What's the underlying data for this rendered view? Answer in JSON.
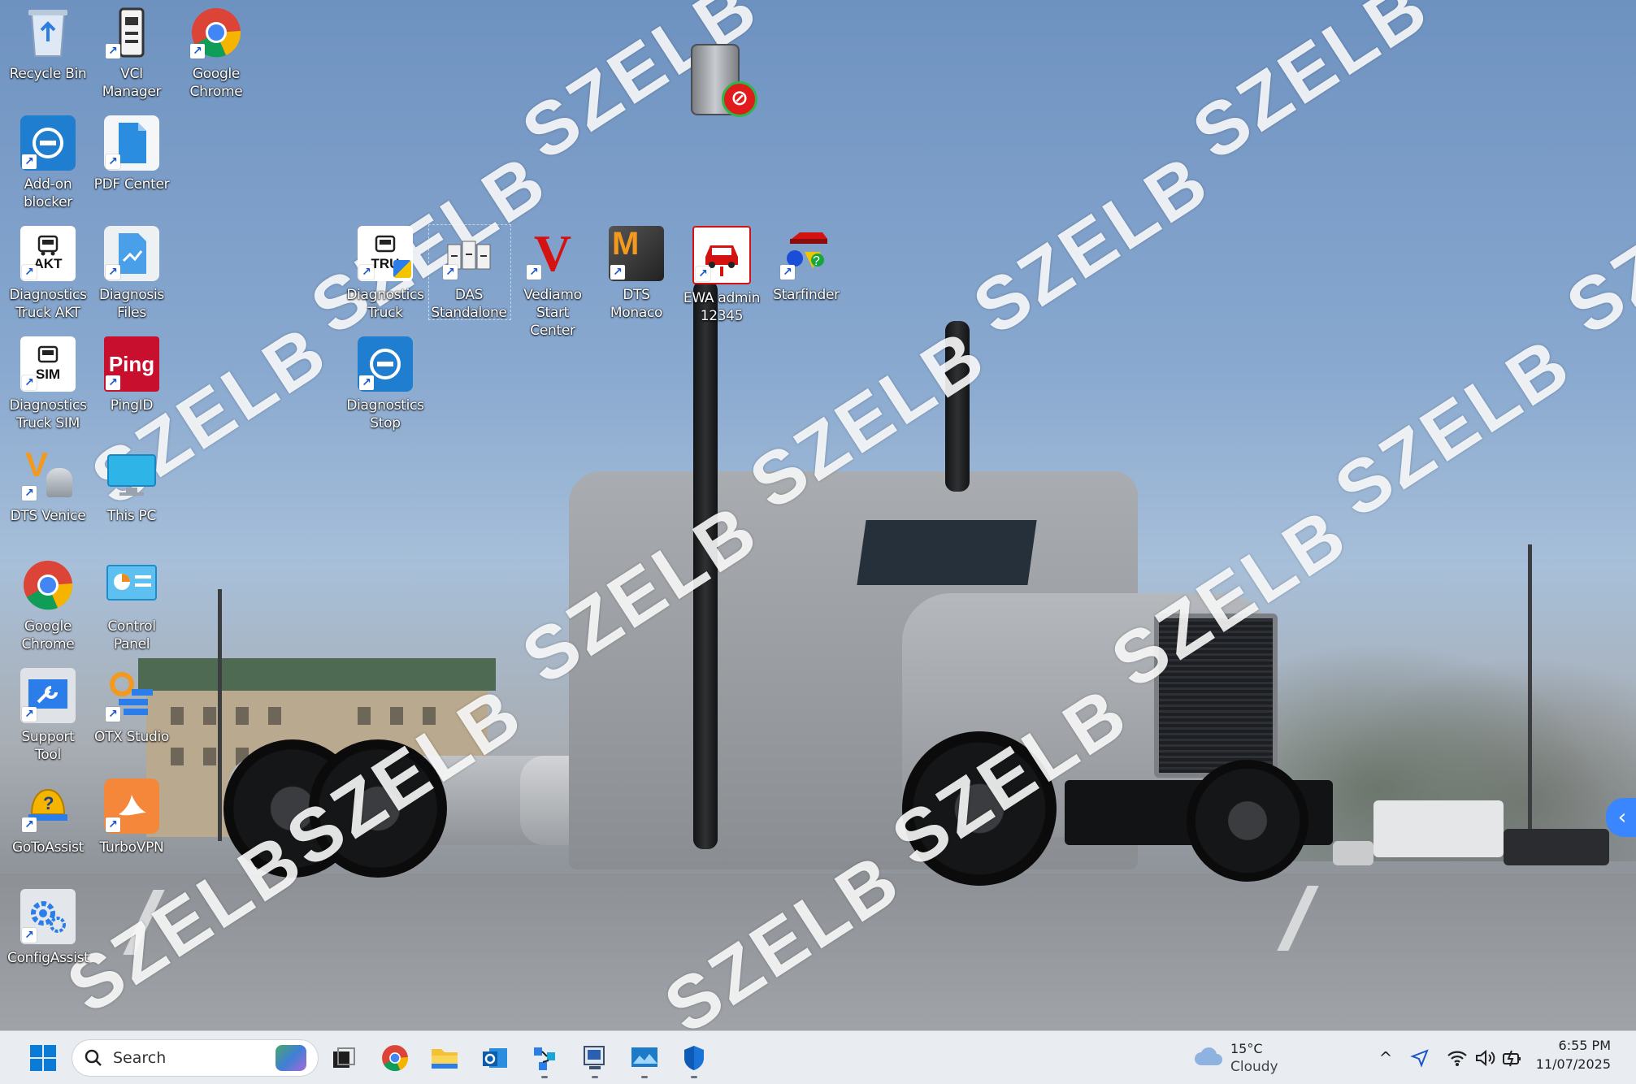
{
  "watermark": {
    "text": "SZELB"
  },
  "desktop_icons": [
    {
      "label_lines": [
        "Recycle Bin"
      ],
      "icon": "recycle-bin-icon"
    },
    {
      "label_lines": [
        "VCI Manager"
      ],
      "icon": "vci-manager-icon"
    },
    {
      "label_lines": [
        "Google",
        "Chrome"
      ],
      "icon": "chrome-icon"
    },
    {
      "label_lines": [
        "Add-on",
        "blocker"
      ],
      "icon": "blocker-icon"
    },
    {
      "label_lines": [
        "PDF Center"
      ],
      "icon": "pdf-icon"
    },
    {
      "label_lines": [
        "Diagnostics",
        "Truck AKT"
      ],
      "icon": "akt-icon",
      "badge": "AKT"
    },
    {
      "label_lines": [
        "Diagnosis",
        "Files"
      ],
      "icon": "files-icon"
    },
    {
      "label_lines": [
        "Diagnostics",
        "Truck"
      ],
      "icon": "truck-diag-icon",
      "badge": "TRU"
    },
    {
      "label_lines": [
        "DAS",
        "Standalone"
      ],
      "icon": "das-icon"
    },
    {
      "label_lines": [
        "Vediamo",
        "Start Center"
      ],
      "icon": "vediamo-icon",
      "badge": "V"
    },
    {
      "label_lines": [
        "DTS Monaco"
      ],
      "icon": "monaco-icon",
      "badge": "M"
    },
    {
      "label_lines": [
        "EWA admin",
        "12345"
      ],
      "icon": "ewa-icon"
    },
    {
      "label_lines": [
        "Starfinder"
      ],
      "icon": "starfinder-icon"
    },
    {
      "label_lines": [
        "Diagnostics",
        "Truck SIM"
      ],
      "icon": "sim-icon",
      "badge": "SIM"
    },
    {
      "label_lines": [
        "PingID"
      ],
      "icon": "pingid-icon",
      "badge": "Ping"
    },
    {
      "label_lines": [
        "Diagnostics",
        "Stop"
      ],
      "icon": "stop-icon"
    },
    {
      "label_lines": [
        "DTS Venice"
      ],
      "icon": "venice-icon",
      "badge": "V"
    },
    {
      "label_lines": [
        "This PC"
      ],
      "icon": "this-pc-icon"
    },
    {
      "label_lines": [
        "Google",
        "Chrome"
      ],
      "icon": "chrome-icon"
    },
    {
      "label_lines": [
        "Control Panel"
      ],
      "icon": "control-panel-icon"
    },
    {
      "label_lines": [
        "Support Tool"
      ],
      "icon": "support-tool-icon"
    },
    {
      "label_lines": [
        "OTX Studio"
      ],
      "icon": "otx-icon"
    },
    {
      "label_lines": [
        "GoToAssist"
      ],
      "icon": "gotoassist-icon"
    },
    {
      "label_lines": [
        "TurboVPN"
      ],
      "icon": "turbovpn-icon"
    },
    {
      "label_lines": [
        "ConfigAssist"
      ],
      "icon": "configassist-icon"
    }
  ],
  "taskbar": {
    "search_placeholder": "Search",
    "apps": [
      "start-icon",
      "task-view-icon",
      "chrome-icon",
      "file-explorer-icon",
      "outlook-icon",
      "network-app-icon",
      "monitor-app-icon",
      "photos-app-icon",
      "security-shield-icon"
    ]
  },
  "tray": {
    "temperature": "15°C",
    "weather": "Cloudy",
    "time": "6:55 PM",
    "date": "11/07/2025"
  },
  "colors": {
    "taskbar_bg": "#e9edf2",
    "accent": "#0067c0",
    "side_handle": "#3a86ff"
  }
}
